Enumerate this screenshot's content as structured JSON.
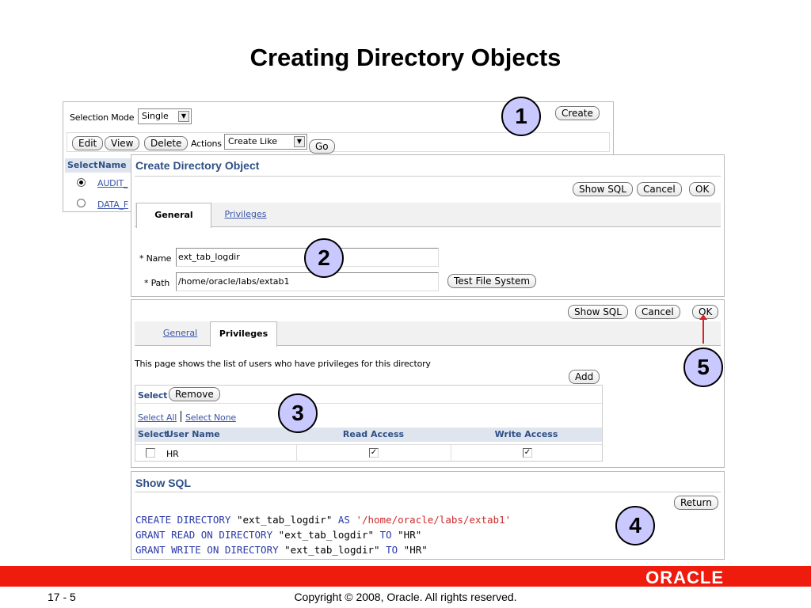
{
  "slide_title": "Creating Directory Objects",
  "list_panel": {
    "selection_mode_label": "Selection Mode",
    "selection_mode_value": "Single",
    "create_button": "Create",
    "edit_button": "Edit",
    "view_button": "View",
    "delete_button": "Delete",
    "actions_label": "Actions",
    "actions_value": "Create Like",
    "go_button": "Go",
    "columns": [
      "Select",
      "Name"
    ],
    "rows": [
      {
        "name": "AUDIT_",
        "selected": true
      },
      {
        "name": "DATA_F",
        "selected": false
      }
    ]
  },
  "create_panel": {
    "header": "Create Directory Object",
    "show_sql_button": "Show SQL",
    "cancel_button": "Cancel",
    "ok_button": "OK",
    "tabs": [
      "General",
      "Privileges"
    ],
    "name_label": "* Name",
    "name_value": "ext_tab_logdir",
    "path_label": "* Path",
    "path_value": "/home/oracle/labs/extab1",
    "test_fs_button": "Test File System"
  },
  "priv_panel": {
    "show_sql_button": "Show SQL",
    "cancel_button": "Cancel",
    "ok_button": "OK",
    "tabs": [
      "General",
      "Privileges"
    ],
    "description": "This page shows the list of users who have privileges for this directory",
    "add_button": "Add",
    "select_label": "Select",
    "remove_button": "Remove",
    "select_all": "Select All",
    "select_none": "Select None",
    "columns": [
      "Select",
      "User Name",
      "Read Access",
      "Write Access"
    ],
    "rows": [
      {
        "user": "HR",
        "selected": false,
        "read": true,
        "write": true
      }
    ]
  },
  "sql_panel": {
    "header": "Show SQL",
    "return_button": "Return",
    "lines": [
      [
        {
          "t": "CREATE DIRECTORY ",
          "c": "kw"
        },
        {
          "t": "\"ext_tab_logdir\" ",
          "c": "dq"
        },
        {
          "t": "AS ",
          "c": "kw"
        },
        {
          "t": "'/home/oracle/labs/extab1'",
          "c": "str"
        }
      ],
      [
        {
          "t": "GRANT READ ON DIRECTORY ",
          "c": "kw"
        },
        {
          "t": "\"ext_tab_logdir\" ",
          "c": "dq"
        },
        {
          "t": "TO ",
          "c": "kw"
        },
        {
          "t": "\"HR\"",
          "c": "dq"
        }
      ],
      [
        {
          "t": "GRANT WRITE ON DIRECTORY ",
          "c": "kw"
        },
        {
          "t": "\"ext_tab_logdir\" ",
          "c": "dq"
        },
        {
          "t": "TO ",
          "c": "kw"
        },
        {
          "t": "\"HR\"",
          "c": "dq"
        }
      ]
    ]
  },
  "callouts": [
    "1",
    "2",
    "3",
    "4",
    "5"
  ],
  "footer": {
    "page_number": "17 - 5",
    "copyright": "Copyright © 2008, Oracle. All rights reserved.",
    "logo": "ORACLE"
  },
  "colors": {
    "accent_red": "#ef1c0e",
    "header_blue": "#2e4f86",
    "callout_fill": "#c9c9ff",
    "link_blue": "#3a55a5"
  }
}
